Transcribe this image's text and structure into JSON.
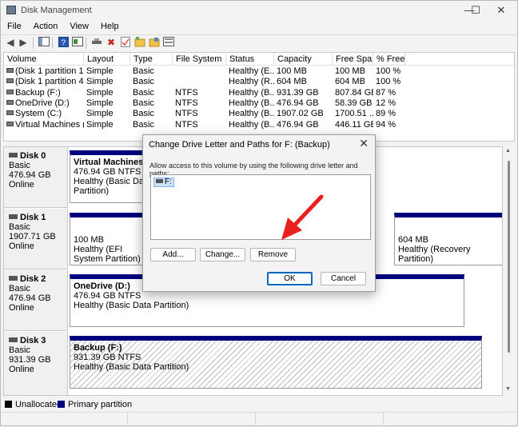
{
  "window": {
    "title": "Disk Management",
    "minimize": "—",
    "maximize": "☐",
    "close": "✕"
  },
  "menu": [
    "File",
    "Action",
    "View",
    "Help"
  ],
  "toolbar_icons": [
    "back-icon",
    "forward-icon",
    "console-tree-icon",
    "help-icon",
    "properties-icon",
    "connect-icon",
    "delete-icon",
    "check-icon",
    "new-folder-icon",
    "open-icon",
    "settings-icon"
  ],
  "volume_list": {
    "columns": [
      "Volume",
      "Layout",
      "Type",
      "File System",
      "Status",
      "Capacity",
      "Free Spa...",
      "% Free"
    ],
    "rows": [
      [
        "(Disk 1 partition 1)",
        "Simple",
        "Basic",
        "",
        "Healthy (E...",
        "100 MB",
        "100 MB",
        "100 %"
      ],
      [
        "(Disk 1 partition 4)",
        "Simple",
        "Basic",
        "",
        "Healthy (R...",
        "604 MB",
        "604 MB",
        "100 %"
      ],
      [
        "Backup (F:)",
        "Simple",
        "Basic",
        "NTFS",
        "Healthy (B...",
        "931.39 GB",
        "807.84 GB",
        "87 %"
      ],
      [
        "OneDrive (D:)",
        "Simple",
        "Basic",
        "NTFS",
        "Healthy (B...",
        "476.94 GB",
        "58.39 GB",
        "12 %"
      ],
      [
        "System (C:)",
        "Simple",
        "Basic",
        "NTFS",
        "Healthy (B...",
        "1907.02 GB",
        "1700.51 ...",
        "89 %"
      ],
      [
        "Virtual Machines (...",
        "Simple",
        "Basic",
        "NTFS",
        "Healthy (B...",
        "476.94 GB",
        "446.11 GB",
        "94 %"
      ]
    ]
  },
  "disks": [
    {
      "name": "Disk 0",
      "type": "Basic",
      "size": "476.94 GB",
      "state": "Online",
      "partitions": [
        {
          "name": "Virtual Machines  (E:)",
          "size": "476.94 GB NTFS",
          "status": "Healthy (Basic Data Partition)"
        }
      ]
    },
    {
      "name": "Disk 1",
      "type": "Basic",
      "size": "1907.71 GB",
      "state": "Online",
      "partitions": [
        {
          "name": "",
          "size": "100 MB",
          "status": "Healthy (EFI System Partition)"
        },
        {
          "name": "",
          "size": "604 MB",
          "status": "Healthy (Recovery Partition)"
        }
      ]
    },
    {
      "name": "Disk 2",
      "type": "Basic",
      "size": "476.94 GB",
      "state": "Online",
      "partitions": [
        {
          "name": "OneDrive  (D:)",
          "size": "476.94 GB NTFS",
          "status": "Healthy (Basic Data Partition)"
        }
      ]
    },
    {
      "name": "Disk 3",
      "type": "Basic",
      "size": "931.39 GB",
      "state": "Online",
      "partitions": [
        {
          "name": "Backup  (F:)",
          "size": "931.39 GB NTFS",
          "status": "Healthy (Basic Data Partition)"
        }
      ]
    }
  ],
  "legend": [
    {
      "label": "Unallocated",
      "color": "#000000"
    },
    {
      "label": "Primary partition",
      "color": "#00007f"
    }
  ],
  "dialog": {
    "title": "Change Drive Letter and Paths for F: (Backup)",
    "prompt": "Allow access to this volume by using the following drive letter and paths:",
    "items": [
      "F:"
    ],
    "add_label": "Add...",
    "change_label": "Change...",
    "remove_label": "Remove",
    "ok_label": "OK",
    "cancel_label": "Cancel",
    "close": "✕"
  },
  "colors": {
    "primary_partition": "#00007f",
    "selection": "#cce4f7",
    "annotation_arrow": "#e8201e"
  }
}
